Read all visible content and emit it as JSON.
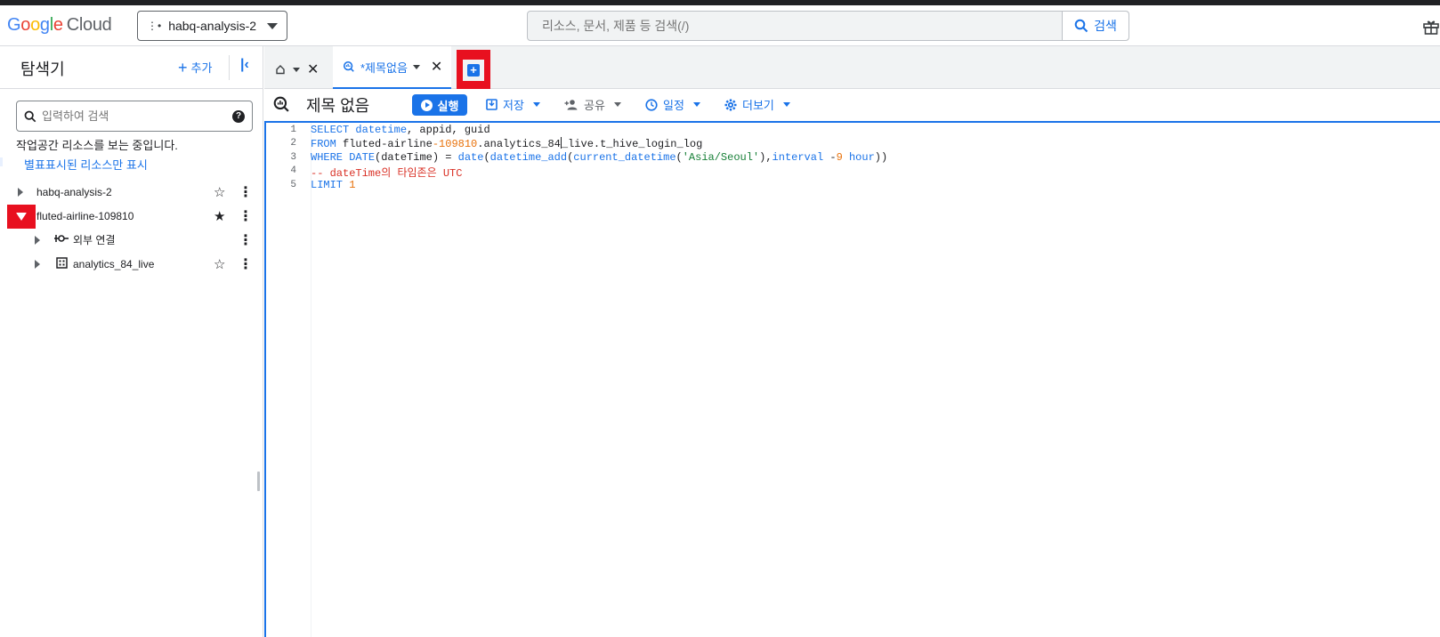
{
  "header": {
    "logo_google": [
      "G",
      "o",
      "o",
      "g",
      "l",
      "e"
    ],
    "logo_cloud": "Cloud",
    "project": "habq-analysis-2",
    "search_placeholder": "리소스, 문서, 제품 등 검색(/)",
    "search_button": "검색"
  },
  "explorer": {
    "title": "탐색기",
    "add_label": "추가",
    "search_placeholder": "입력하여 검색",
    "info_text": "작업공간 리소스를 보는 중입니다.",
    "starred_link": "별표표시된 리소스만 표시",
    "tree": [
      {
        "label": "habq-analysis-2",
        "starred": false
      },
      {
        "label": "fluted-airline-109810",
        "starred": true,
        "expanded": true
      },
      {
        "label": "외부 연결",
        "icon": "connection-icon"
      },
      {
        "label": "analytics_84_live",
        "icon": "dataset-icon",
        "starred": false
      }
    ]
  },
  "tabs": {
    "active_label": "*제목없음"
  },
  "toolbar": {
    "title": "제목 없음",
    "run": "실행",
    "save": "저장",
    "share": "공유",
    "schedule": "일정",
    "more": "더보기"
  },
  "editor": {
    "line_numbers": [
      "1",
      "2",
      "3",
      "4",
      "5"
    ],
    "lines": [
      "SELECT datetime, appid, guid",
      "FROM fluted-airline-109810.analytics_84_live.t_hive_login_log",
      "WHERE DATE(dateTime) = date(datetime_add(current_datetime('Asia/Seoul'),interval -9 hour))",
      "-- dateTime의 타임존은 UTC",
      "LIMIT 1"
    ]
  },
  "colors": {
    "accent": "#1a73e8",
    "highlight": "#e8101f"
  }
}
